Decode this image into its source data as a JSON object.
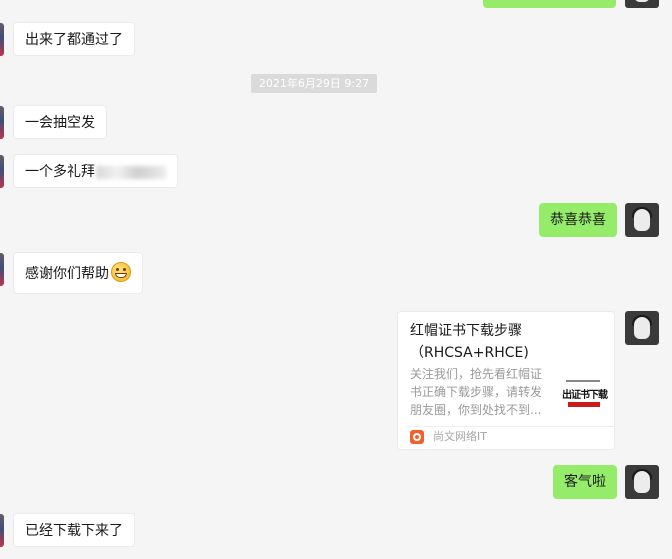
{
  "messages": {
    "m1": "出来了都通过了",
    "timestamp": "2021年6月29日 9:27",
    "m2": "一会抽空发",
    "m3_visible": "一个多礼拜",
    "m4": "恭喜恭喜",
    "m5": "感谢你们帮助",
    "m6": "客气啦",
    "m7": "已经下载下来了"
  },
  "card": {
    "title": "红帽证书下载步骤（RHCSA+RHCE)",
    "description": "关注我们，抢先看红帽证书正确下载步骤，请转发朋友圈，你到处找不到...",
    "source": "尚文网络IT",
    "thumbnail_text": "出证书下载"
  },
  "colors": {
    "background": "#f5f5f5",
    "sent_bubble": "#95ec69",
    "received_bubble": "#ffffff",
    "time_chip": "#dadada"
  }
}
